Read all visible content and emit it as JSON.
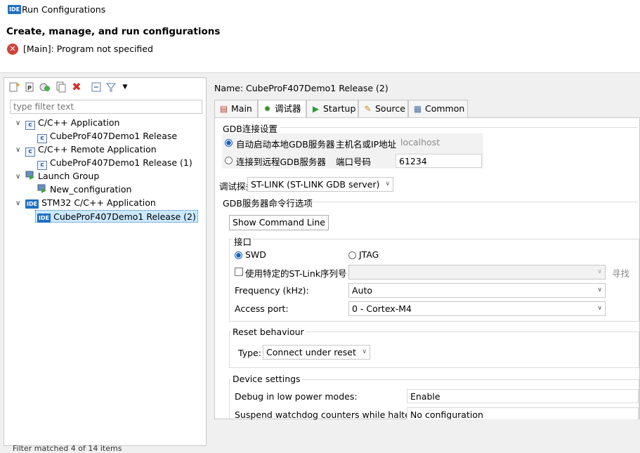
{
  "window": {
    "title": "Run Configurations",
    "badge": "IDE"
  },
  "header": {
    "title": "Create, manage, and run configurations",
    "error_icon": "error-x-icon",
    "message": "[Main]: Program not specified"
  },
  "left": {
    "toolbar": [
      "new-config-icon",
      "new-prototype-icon",
      "export-icon",
      "duplicate-icon",
      "delete-icon",
      "collapse-all-icon",
      "filter-icon",
      "dropdown-icon"
    ],
    "filter_placeholder": "type filter text",
    "tree": [
      {
        "label": "C/C++ Application",
        "children": [
          "CubeProF407Demo1 Release"
        ]
      },
      {
        "label": "C/C++ Remote Application",
        "children": [
          "CubeProF407Demo1 Release (1)"
        ]
      },
      {
        "label": "Launch Group",
        "children": [
          "New_configuration"
        ]
      },
      {
        "label": "STM32 C/C++ Application",
        "children": [
          "CubeProF407Demo1 Release (2)"
        ]
      }
    ],
    "icon_badge": "IDE",
    "c_badge": "c",
    "footer": "Filter matched 4 of 14 items"
  },
  "right": {
    "name_label": "Name:",
    "name_value": "CubeProF407Demo1 Release (2)",
    "tabs": [
      {
        "label": "Main",
        "icon": "main-tab-icon"
      },
      {
        "label": "调试器",
        "icon": "debugger-tab-icon"
      },
      {
        "label": "Startup",
        "icon": "startup-tab-icon"
      },
      {
        "label": "Source",
        "icon": "source-tab-icon"
      },
      {
        "label": "Common",
        "icon": "common-tab-icon"
      }
    ],
    "gdb_section": "GDB连接设置",
    "local_gdb": "自动启动本地GDB服务器",
    "host_label": "主机名或IP地址",
    "host_value": "localhost",
    "remote_gdb": "连接到远程GDB服务器",
    "port_label": "端口号码",
    "port_value": "61234",
    "probe_label": "调试探头",
    "probe_value": "ST-LINK (ST-LINK GDB server)",
    "server_options": "GDB服务器命令行选项",
    "show_cmd": "Show Command Line",
    "interface_label": "接口",
    "swd": "SWD",
    "jtag": "JTAG",
    "specific_stlink": "使用特定的ST-Link序列号",
    "find": "寻找",
    "frequency_label": "Frequency (kHz):",
    "frequency_value": "Auto",
    "access_port_label": "Access port:",
    "access_port_value": "0 - Cortex-M4",
    "reset_section": "Reset behaviour",
    "type_label": "Type:",
    "type_value": "Connect under reset",
    "device_section": "Device settings",
    "debug_low_power_label": "Debug in low power modes:",
    "debug_low_power_value": "Enable",
    "suspend_watchdog_label": "Suspend watchdog counters while halted:",
    "suspend_watchdog_value": "No configuration"
  }
}
